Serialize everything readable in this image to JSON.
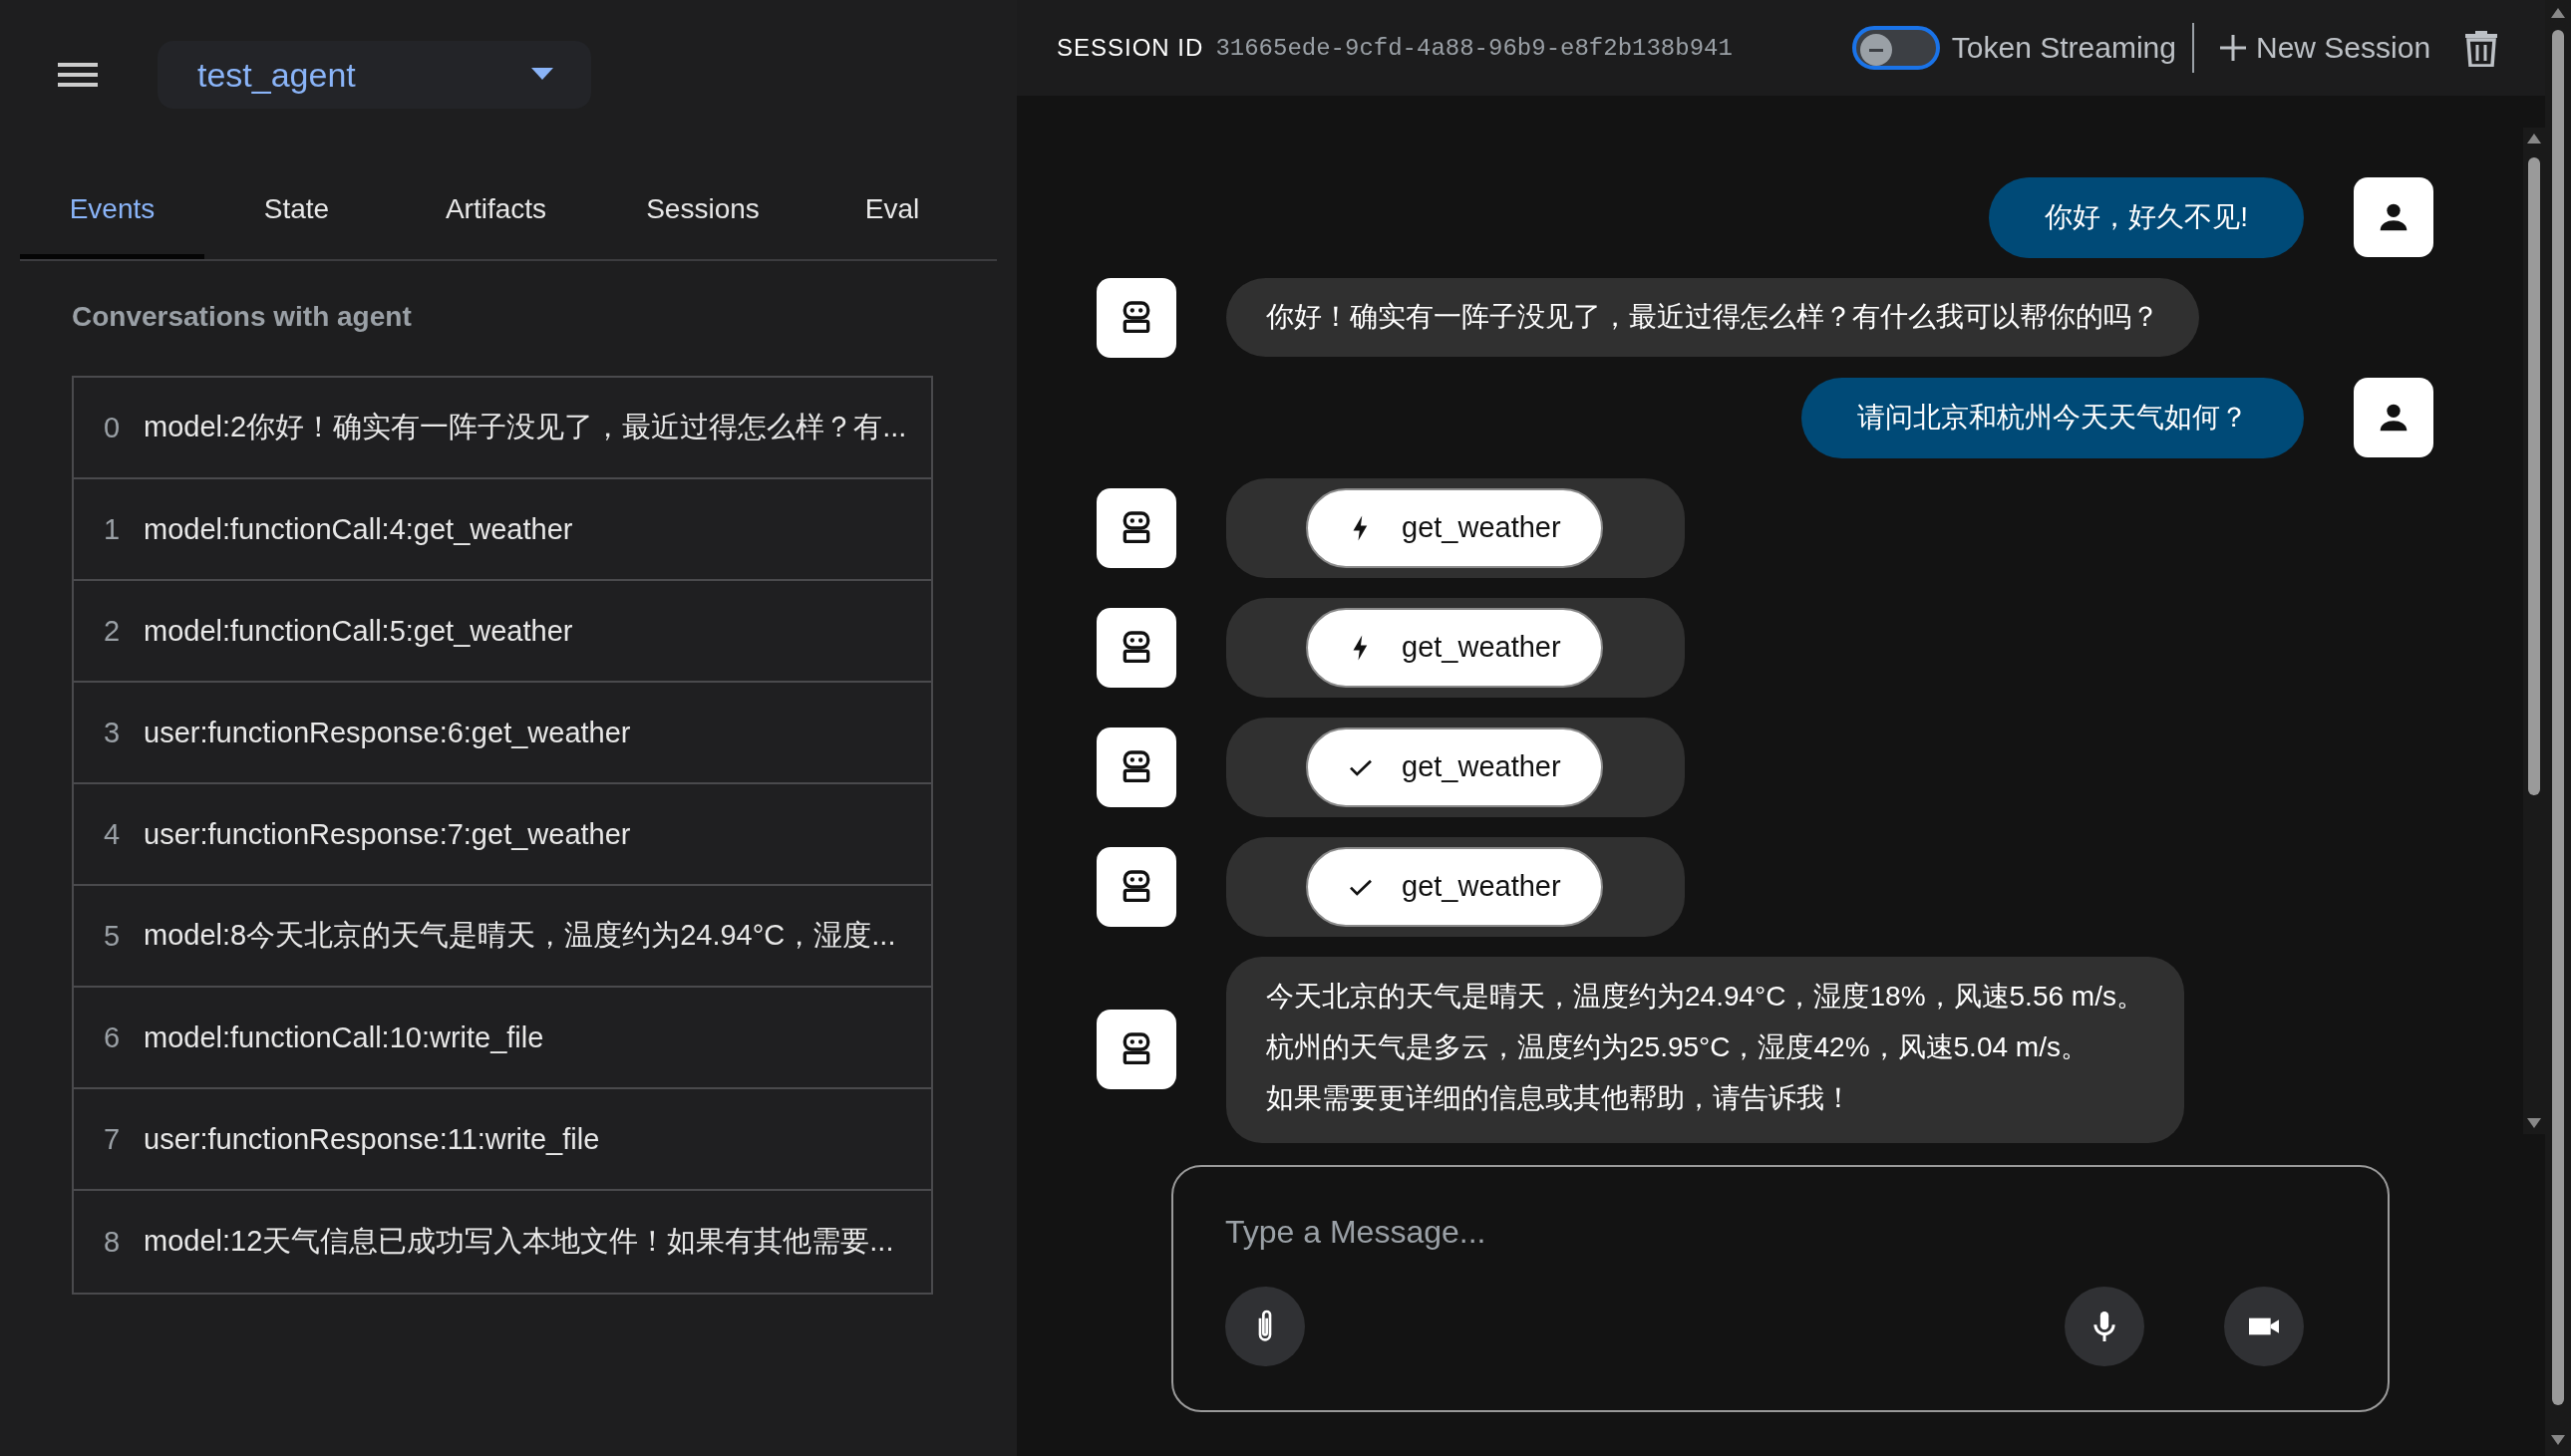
{
  "sidebar": {
    "agent": "test_agent",
    "tabs": [
      {
        "label": "Events",
        "selected": true
      },
      {
        "label": "State",
        "selected": false
      },
      {
        "label": "Artifacts",
        "selected": false
      },
      {
        "label": "Sessions",
        "selected": false
      },
      {
        "label": "Eval",
        "selected": false
      }
    ],
    "events_title": "Conversations with agent",
    "events": [
      {
        "index": "0",
        "text": "model:2你好！确实有一阵子没见了，最近过得怎么样？有..."
      },
      {
        "index": "1",
        "text": "model:functionCall:4:get_weather"
      },
      {
        "index": "2",
        "text": "model:functionCall:5:get_weather"
      },
      {
        "index": "3",
        "text": "user:functionResponse:6:get_weather"
      },
      {
        "index": "4",
        "text": "user:functionResponse:7:get_weather"
      },
      {
        "index": "5",
        "text": "model:8今天北京的天气是晴天，温度约为24.94°C，湿度..."
      },
      {
        "index": "6",
        "text": "model:functionCall:10:write_file"
      },
      {
        "index": "7",
        "text": "user:functionResponse:11:write_file"
      },
      {
        "index": "8",
        "text": "model:12天气信息已成功写入本地文件！如果有其他需要..."
      }
    ]
  },
  "header": {
    "session_label": "SESSION ID",
    "session_id": "31665ede-9cfd-4a88-96b9-e8f2b138b941",
    "token_streaming": {
      "label": "Token Streaming",
      "on": false
    },
    "new_session": "New Session"
  },
  "messages": [
    {
      "kind": "user_text",
      "lines": [
        "你好，好久不见!"
      ]
    },
    {
      "kind": "bot_text",
      "lines": [
        "你好！确实有一阵子没见了，最近过得怎么样？有什么我可以帮你的吗？"
      ]
    },
    {
      "kind": "user_text",
      "lines": [
        "请问北京和杭州今天天气如何？"
      ]
    },
    {
      "kind": "call",
      "name": "get_weather"
    },
    {
      "kind": "call",
      "name": "get_weather"
    },
    {
      "kind": "response",
      "name": "get_weather"
    },
    {
      "kind": "response",
      "name": "get_weather"
    },
    {
      "kind": "bot_text",
      "lines": [
        "今天北京的天气是晴天，温度约为24.94°C，湿度18%，风速5.56 m/s。",
        "杭州的天气是多云，温度约为25.95°C，湿度42%，风速5.04 m/s。",
        "如果需要更详细的信息或其他帮助，请告诉我！"
      ]
    }
  ],
  "input": {
    "placeholder": "Type a Message..."
  }
}
